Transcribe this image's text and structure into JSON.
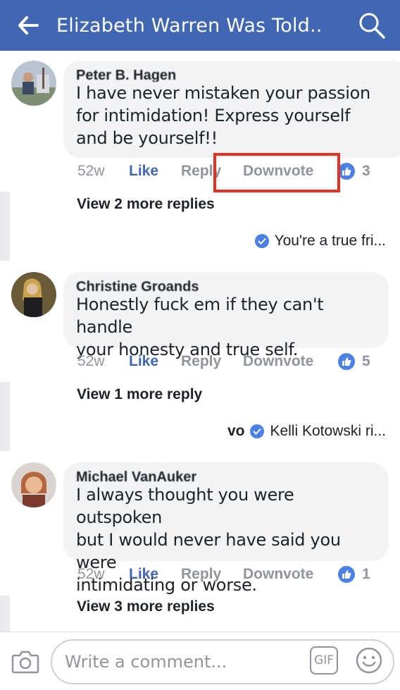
{
  "header": {
    "title": "Elizabeth Warren Was Told..."
  },
  "comments": [
    {
      "author": "Peter B. Hagen",
      "text_lines": [
        "I have never mistaken your passion",
        "for intimidation! Express yourself",
        "and be yourself!!"
      ],
      "time": "52w",
      "like": "Like",
      "reply": "Reply",
      "downvote": "Downvote",
      "reactions": "3",
      "view_more": "View 2 more replies",
      "preview": "You're a true fri..."
    },
    {
      "author": "Christine Groands",
      "text_lines": [
        "Honestly fuck em if they can't handle",
        "your honesty and true self."
      ],
      "time": "52w",
      "like": "Like",
      "reply": "Reply",
      "downvote": "Downvote",
      "reactions": "5",
      "view_more": "View 1 more reply",
      "preview_prefix": "vo",
      "preview": "Kelli Kotowski ri..."
    },
    {
      "author": "Michael VanAuker",
      "text_lines": [
        "I always thought you were outspoken",
        "but I would never have said you were",
        "intimidating or worse."
      ],
      "time": "52w",
      "like": "Like",
      "reply": "Reply",
      "downvote": "Downvote",
      "reactions": "1",
      "view_more": "View 3 more replies"
    }
  ],
  "composer": {
    "placeholder": "Write a comment...",
    "gif": "GIF"
  },
  "colors": {
    "brand": "#4267b2",
    "highlight": "#e53223",
    "muted": "#90949c"
  }
}
